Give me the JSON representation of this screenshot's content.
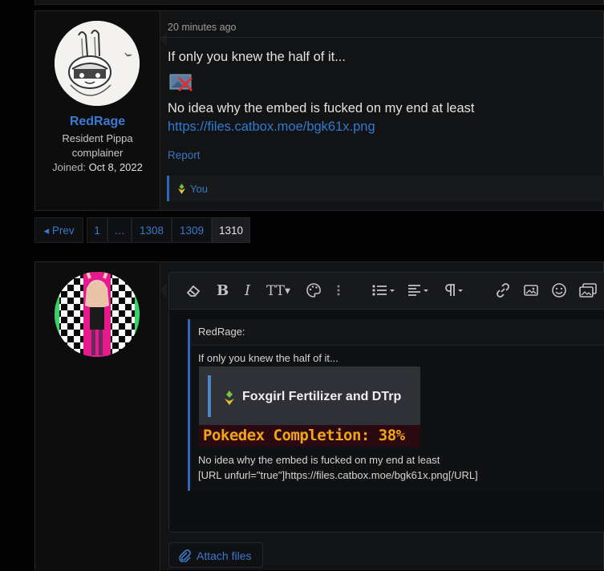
{
  "post": {
    "time": "20 minutes ago",
    "user": {
      "name": "RedRage",
      "title": "Resident Pippa complainer",
      "joined_label": "Joined:",
      "joined_date": "Oct 8, 2022"
    },
    "body_line1": "If only you knew the half of it...",
    "body_line2": "No idea why the embed is fucked on my end at least",
    "link": "https://files.catbox.moe/bgk61x.png",
    "report_label": "Report",
    "reaction_user": "You"
  },
  "pagination": {
    "prev_label": "◂ Prev",
    "pages": [
      "1",
      "…",
      "1308",
      "1309",
      "1310"
    ],
    "current": "1310"
  },
  "editor": {
    "toolbar_icons": [
      "eraser-icon",
      "bold-icon",
      "italic-icon",
      "text-size-icon",
      "palette-icon",
      "more-vertical-icon",
      "list-icon",
      "align-icon",
      "paragraph-icon",
      "link-icon",
      "image-icon",
      "smiley-icon",
      "media-icon"
    ],
    "quote_author": "RedRage:",
    "quote_line1": "If only you knew the half of it...",
    "embed_title": "Foxgirl Fertilizer and DTrp",
    "embed_caption": "Pokedex Completion: 38%",
    "quote_line2": "No idea why the embed is fucked on my end at least",
    "quote_line3": "[URL unfurl=\"true\"]https://files.catbox.moe/bgk61x.png[/URL]",
    "attach_label": "Attach files"
  },
  "colors": {
    "accent": "#3b79cc",
    "username": "#3c7bd3",
    "background": "#030303",
    "panel": "#121314"
  }
}
